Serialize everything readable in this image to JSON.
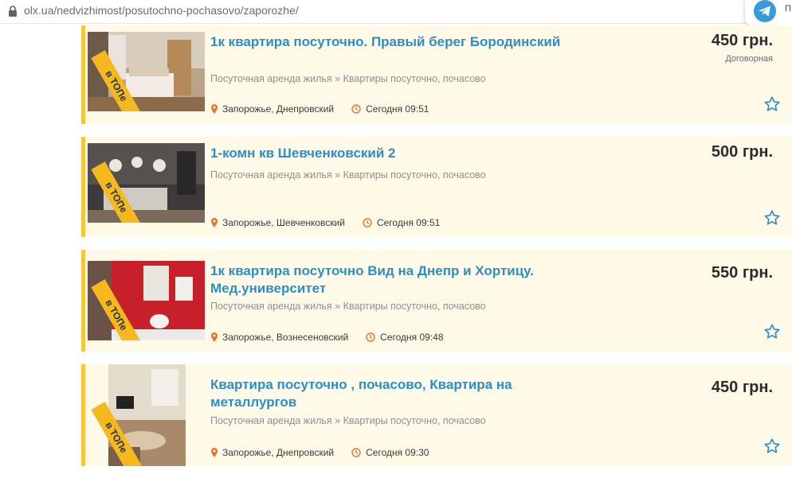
{
  "browser": {
    "url": "olx.ua/nedvizhimost/posutochno-pochasovo/zaporozhe/",
    "extension_label": "П"
  },
  "colors": {
    "title_link": "#2a8fc9",
    "listing_bg": "#fff9e8",
    "top_accent": "#f7c53a",
    "icon_accent": "#e8752b",
    "star": "#2a8fc9"
  },
  "listings": [
    {
      "title": "1к квартира посуточно. Правый берег Бородинский",
      "category": "Посуточная аренда жилья » Квартиры посуточно, почасово",
      "location": "Запорожье, Днепровский",
      "time": "Сегодня 09:51",
      "price": "450 грн.",
      "price_note": "Договорная",
      "badge": "в ТОПе",
      "thumb_icon": "bedroom-photo"
    },
    {
      "title": "1-комн кв Шевченковский 2",
      "category": "Посуточная аренда жилья » Квартиры посуточно, почасово",
      "location": "Запорожье, Шевченковский",
      "time": "Сегодня 09:51",
      "price": "500 грн.",
      "price_note": "",
      "badge": "в ТОПе",
      "thumb_icon": "dark-bedroom-photo"
    },
    {
      "title": "1к квартира посуточно Вид на Днепр и Хортицу. Мед.университет",
      "category": "Посуточная аренда жилья » Квартиры посуточно, почасово",
      "location": "Запорожье, Вознесеновский",
      "time": "Сегодня 09:48",
      "price": "550 грн.",
      "price_note": "",
      "badge": "в ТОПе",
      "thumb_icon": "red-bathroom-photo"
    },
    {
      "title": "Квартира посуточно , почасово, Квартира на металлургов",
      "category": "Посуточная аренда жилья » Квартиры посуточно, почасово",
      "location": "Запорожье, Днепровский",
      "time": "Сегодня 09:30",
      "price": "450 грн.",
      "price_note": "",
      "badge": "в ТОПе",
      "thumb_icon": "living-room-photo"
    }
  ]
}
